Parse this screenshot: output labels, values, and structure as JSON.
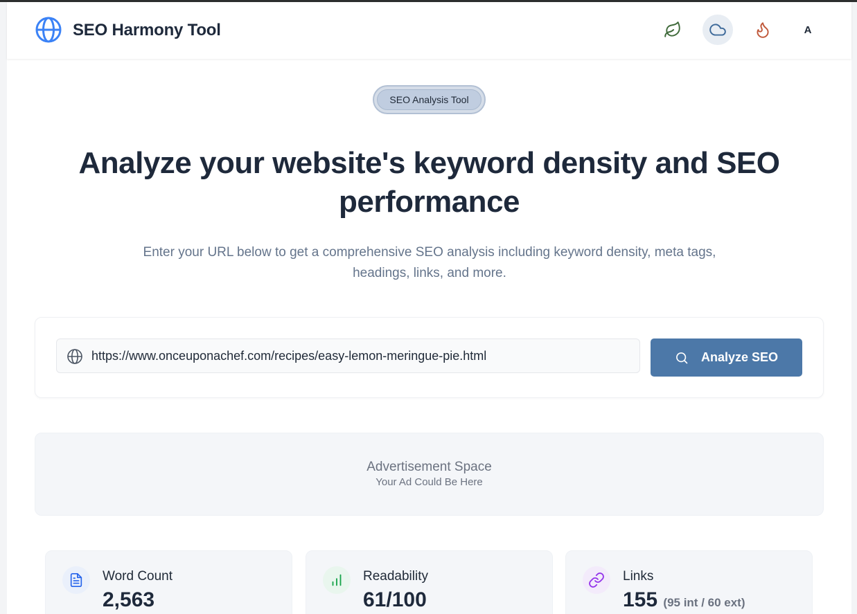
{
  "header": {
    "brand": "SEO Harmony Tool",
    "themes": [
      {
        "name": "nature",
        "icon": "leaf-icon",
        "color": "#3f6a3a"
      },
      {
        "name": "cloud",
        "icon": "cloud-icon",
        "color": "#3e6a9a",
        "active": true
      },
      {
        "name": "fire",
        "icon": "flame-icon",
        "color": "#c0583a"
      },
      {
        "name": "text",
        "label": "A"
      }
    ]
  },
  "hero": {
    "badge": "SEO Analysis Tool",
    "title": "Analyze your website's keyword density and SEO performance",
    "subtitle": "Enter your URL below to get a comprehensive SEO analysis including keyword density, meta tags, headings, links, and more."
  },
  "search": {
    "url_value": "https://www.onceuponachef.com/recipes/easy-lemon-meringue-pie.html",
    "button_label": "Analyze SEO"
  },
  "ad": {
    "title": "Advertisement Space",
    "subtitle": "Your Ad Could Be Here"
  },
  "stats": [
    {
      "label": "Word Count",
      "value": "2,563",
      "icon": "document-icon",
      "color": "#2563eb"
    },
    {
      "label": "Readability",
      "value": "61/100",
      "icon": "bar-chart-icon",
      "color": "#16a34a"
    },
    {
      "label": "Links",
      "value": "155",
      "extra": "(95 int / 60 ext)",
      "icon": "link-icon",
      "color": "#9333ea"
    }
  ],
  "colors": {
    "accent": "#4c78a8",
    "brand_globe": "#3b82f6"
  }
}
